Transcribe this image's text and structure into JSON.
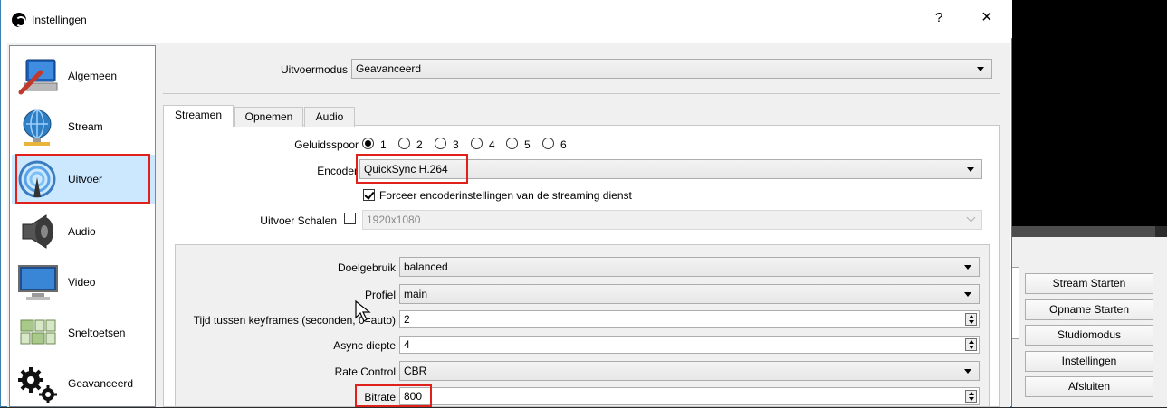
{
  "dialog": {
    "title": "Instellingen",
    "help": "?",
    "close": "×"
  },
  "sidebar": {
    "items": [
      {
        "label": "Algemeen",
        "icon": "general-monitor-icon"
      },
      {
        "label": "Stream",
        "icon": "stream-globe-icon"
      },
      {
        "label": "Uitvoer",
        "icon": "output-broadcast-icon",
        "selected": true
      },
      {
        "label": "Audio",
        "icon": "speaker-icon"
      },
      {
        "label": "Video",
        "icon": "monitor-icon"
      },
      {
        "label": "Sneltoetsen",
        "icon": "keyboard-icon"
      },
      {
        "label": "Geavanceerd",
        "icon": "gears-icon"
      }
    ]
  },
  "output_mode": {
    "label": "Uitvoermodus",
    "value": "Geavanceerd"
  },
  "tabs": [
    {
      "label": "Streamen",
      "active": true
    },
    {
      "label": "Opnemen"
    },
    {
      "label": "Audio"
    }
  ],
  "audio_track": {
    "label": "Geluidsspoor",
    "options": [
      "1",
      "2",
      "3",
      "4",
      "5",
      "6"
    ],
    "selected": "1"
  },
  "encoder": {
    "label": "Encoder",
    "value": "QuickSync H.264"
  },
  "enforce": {
    "label": "Forceer encoderinstellingen van de streaming dienst",
    "checked": true
  },
  "rescale": {
    "label": "Uitvoer Schalen",
    "checked": false,
    "value": "1920x1080"
  },
  "encoder_settings": {
    "target_usage": {
      "label": "Doelgebruik",
      "value": "balanced"
    },
    "profile": {
      "label": "Profiel",
      "value": "main"
    },
    "keyframes": {
      "label": "Tijd tussen keyframes (seconden, 0=auto)",
      "value": "2"
    },
    "async_depth": {
      "label": "Async diepte",
      "value": "4"
    },
    "rate_control": {
      "label": "Rate Control",
      "value": "CBR"
    },
    "bitrate": {
      "label": "Bitrate",
      "value": "800"
    }
  },
  "main_window": {
    "buttons": [
      "Stream Starten",
      "Opname Starten",
      "Studiomodus",
      "Instellingen",
      "Afsluiten"
    ]
  },
  "colors": {
    "highlight": "#e0201b",
    "selection": "#cce8ff"
  }
}
